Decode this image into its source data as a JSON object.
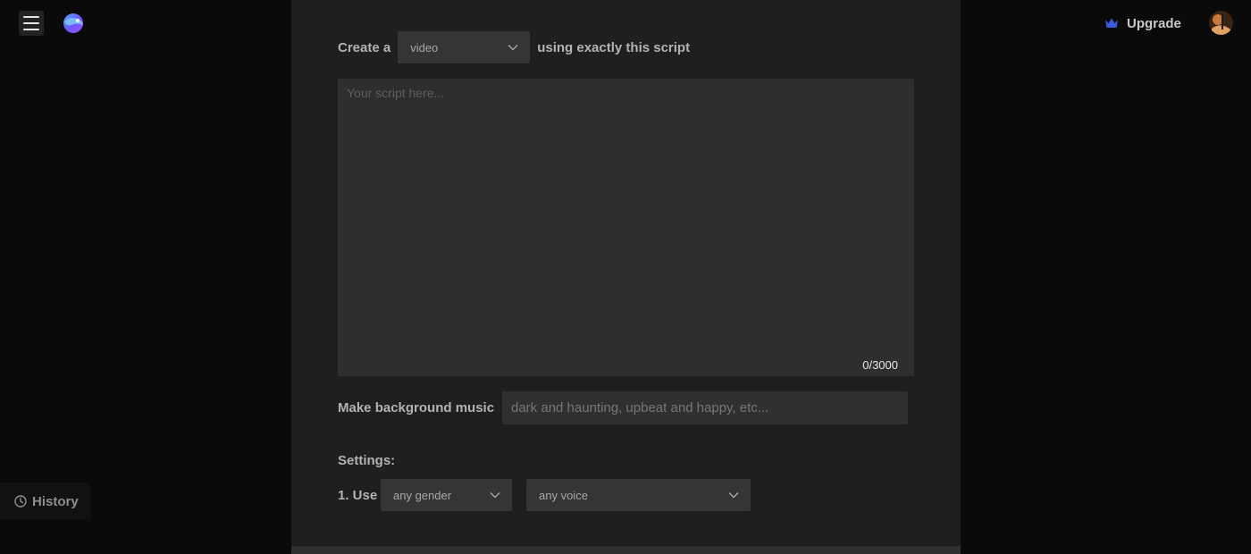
{
  "header": {
    "menu_icon": "hamburger-menu-icon",
    "logo_icon": "app-logo-icon",
    "upgrade_label": "Upgrade",
    "upgrade_icon": "crown-icon",
    "avatar_icon": "user-avatar-icon"
  },
  "sidebar": {
    "history_label": "History",
    "history_icon": "clock-icon"
  },
  "form": {
    "create_prefix": "Create a",
    "media_type_selected": "video",
    "create_suffix": "using exactly this script",
    "script_placeholder": "Your script here...",
    "script_counter": "0/3000",
    "music_label": "Make background music",
    "music_placeholder": "dark and haunting, upbeat and happy, etc...",
    "settings_label": "Settings:",
    "use_label": "1. Use",
    "gender_selected": "any gender",
    "voice_selected": "any voice"
  },
  "colors": {
    "page_bg": "#0a0a0a",
    "panel_bg": "#1f1f1f",
    "field_bg": "#2e2e2e",
    "crown_accent": "#3b5bdb"
  }
}
